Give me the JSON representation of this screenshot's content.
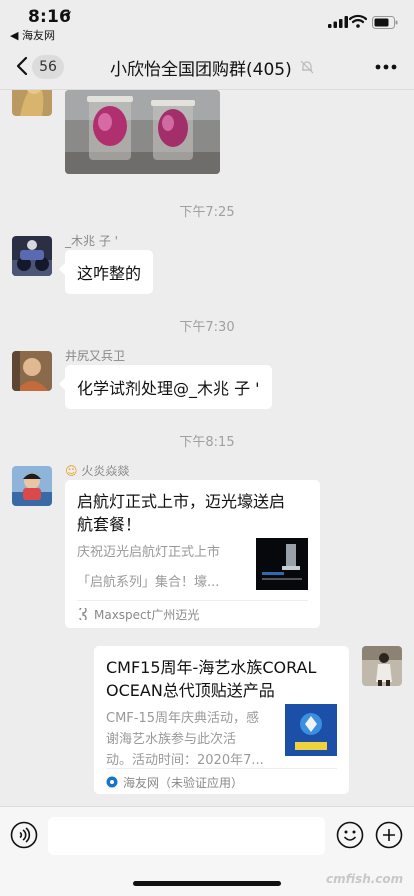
{
  "status_bar": {
    "time": "8:16",
    "back_app": "◀ 海友网"
  },
  "nav": {
    "unread_count": "56",
    "title": "小欣怡全国团购群(405)"
  },
  "chat": {
    "timestamps": [
      "下午7:25",
      "下午7:30",
      "下午8:15"
    ],
    "messages": [
      {
        "sender": "_木兆  子 '",
        "text": "这咋整的"
      },
      {
        "sender": "井尻又兵卫",
        "text": "化学试剂处理@_木兆  子 '"
      }
    ],
    "card1": {
      "sender": "火炎焱燚",
      "title_line1": "启航灯正式上市，迈光壕送启",
      "title_line2": "航套餐！",
      "desc_line1": "庆祝迈光启航灯正式上市",
      "desc_line2": "「启航系列」集合！壕...",
      "source": "Maxspect广州迈光"
    },
    "card2": {
      "title_line1": "CMF15周年-海艺水族CORAL",
      "title_line2": "OCEAN总代顶贴送产品",
      "desc_line1": "CMF-15周年庆典活动，感",
      "desc_line2": "谢海艺水族参与此次活",
      "desc_line3": "动。活动时间：2020年7...",
      "source": "海友网（未验证应用）"
    }
  },
  "input_bar": {
    "placeholder": ""
  },
  "watermark": "cmfish.com",
  "colors": {
    "background": "#ededed",
    "bubble": "#ffffff",
    "muted_text": "#888888"
  }
}
